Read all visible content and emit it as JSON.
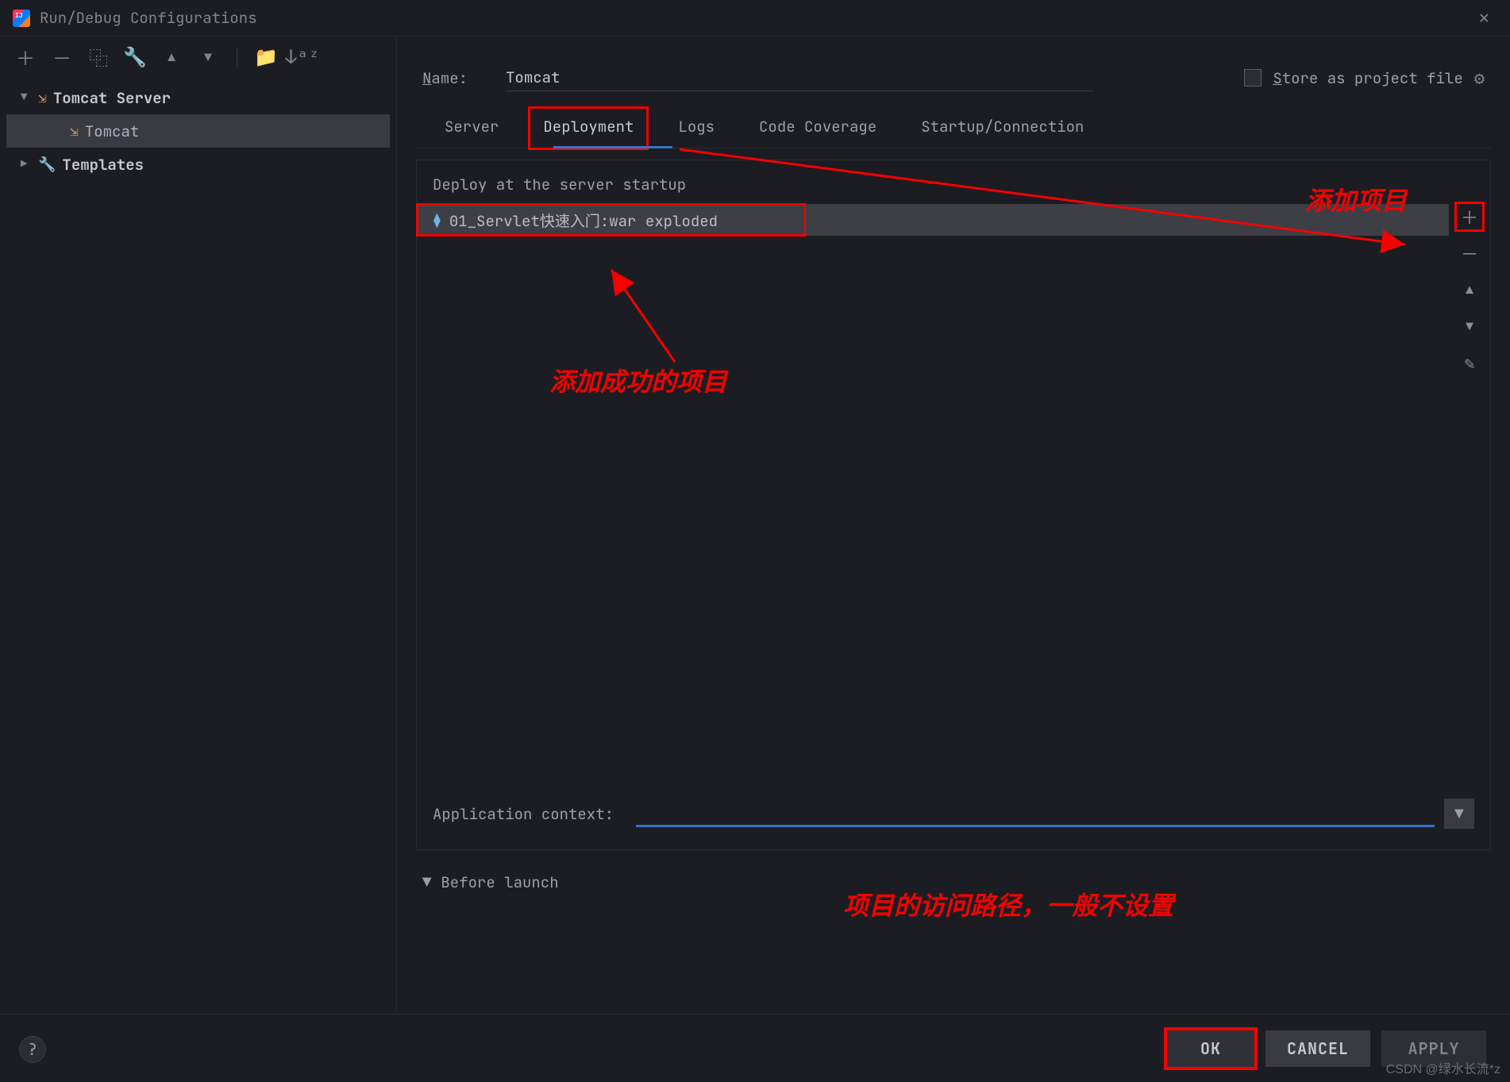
{
  "window": {
    "title": "Run/Debug Configurations",
    "close": "✕"
  },
  "sidebar": {
    "toolbar": {
      "add": "＋",
      "remove": "－",
      "copy": "⿻",
      "wrench": "🔧",
      "up": "▲",
      "down": "▼",
      "folder": "📁",
      "sort": "↓ᵃᶻ"
    },
    "tree": {
      "root": {
        "label": "Tomcat Server"
      },
      "child": {
        "label": "Tomcat"
      },
      "templates": {
        "label": "Templates"
      }
    }
  },
  "main": {
    "name_label": "Name:",
    "name_value": "Tomcat",
    "store_as": "Store as project file",
    "tabs": {
      "server": "Server",
      "deployment": "Deployment",
      "logs": "Logs",
      "code_coverage": "Code Coverage",
      "startup": "Startup/Connection"
    },
    "deploy": {
      "title": "Deploy at the server startup",
      "item": "01_Servlet快速入门:war exploded",
      "actions": {
        "add": "＋",
        "remove": "－",
        "up": "▲",
        "down": "▼",
        "edit": "✎"
      }
    },
    "app_context_label": "Application context:",
    "before_launch": "Before launch"
  },
  "footer": {
    "ok": "OK",
    "cancel": "CANCEL",
    "apply": "APPLY",
    "help": "?"
  },
  "annotations": {
    "add_project": "添加项目",
    "added_ok": "添加成功的项目",
    "context_note": "项目的访问路径，一般不设置"
  },
  "watermark": "CSDN @绿水长流*z"
}
